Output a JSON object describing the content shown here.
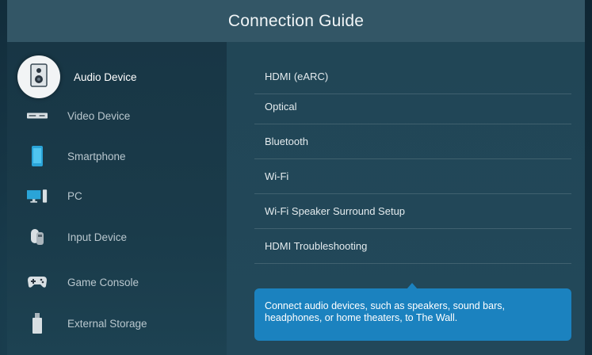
{
  "header": {
    "title": "Connection Guide"
  },
  "categories": [
    {
      "label": "Audio Device",
      "icon": "speaker-icon",
      "selected": true
    },
    {
      "label": "Video Device",
      "icon": "set-top-box-icon"
    },
    {
      "label": "Smartphone",
      "icon": "smartphone-icon"
    },
    {
      "label": "PC",
      "icon": "pc-icon"
    },
    {
      "label": "Input Device",
      "icon": "mouse-icon"
    },
    {
      "label": "Game Console",
      "icon": "gamepad-icon"
    },
    {
      "label": "External Storage",
      "icon": "usb-drive-icon"
    }
  ],
  "options": [
    {
      "label": "HDMI (eARC)"
    },
    {
      "label": "Optical"
    },
    {
      "label": "Bluetooth"
    },
    {
      "label": "Wi-Fi"
    },
    {
      "label": "Wi-Fi Speaker Surround Setup"
    },
    {
      "label": "HDMI Troubleshooting"
    }
  ],
  "tooltip": {
    "text": "Connect audio devices, such as speakers, sound bars, headphones, or home theaters, to The Wall."
  },
  "colors": {
    "accent": "#1b82bf",
    "header": "#335666",
    "background": "#163646"
  }
}
